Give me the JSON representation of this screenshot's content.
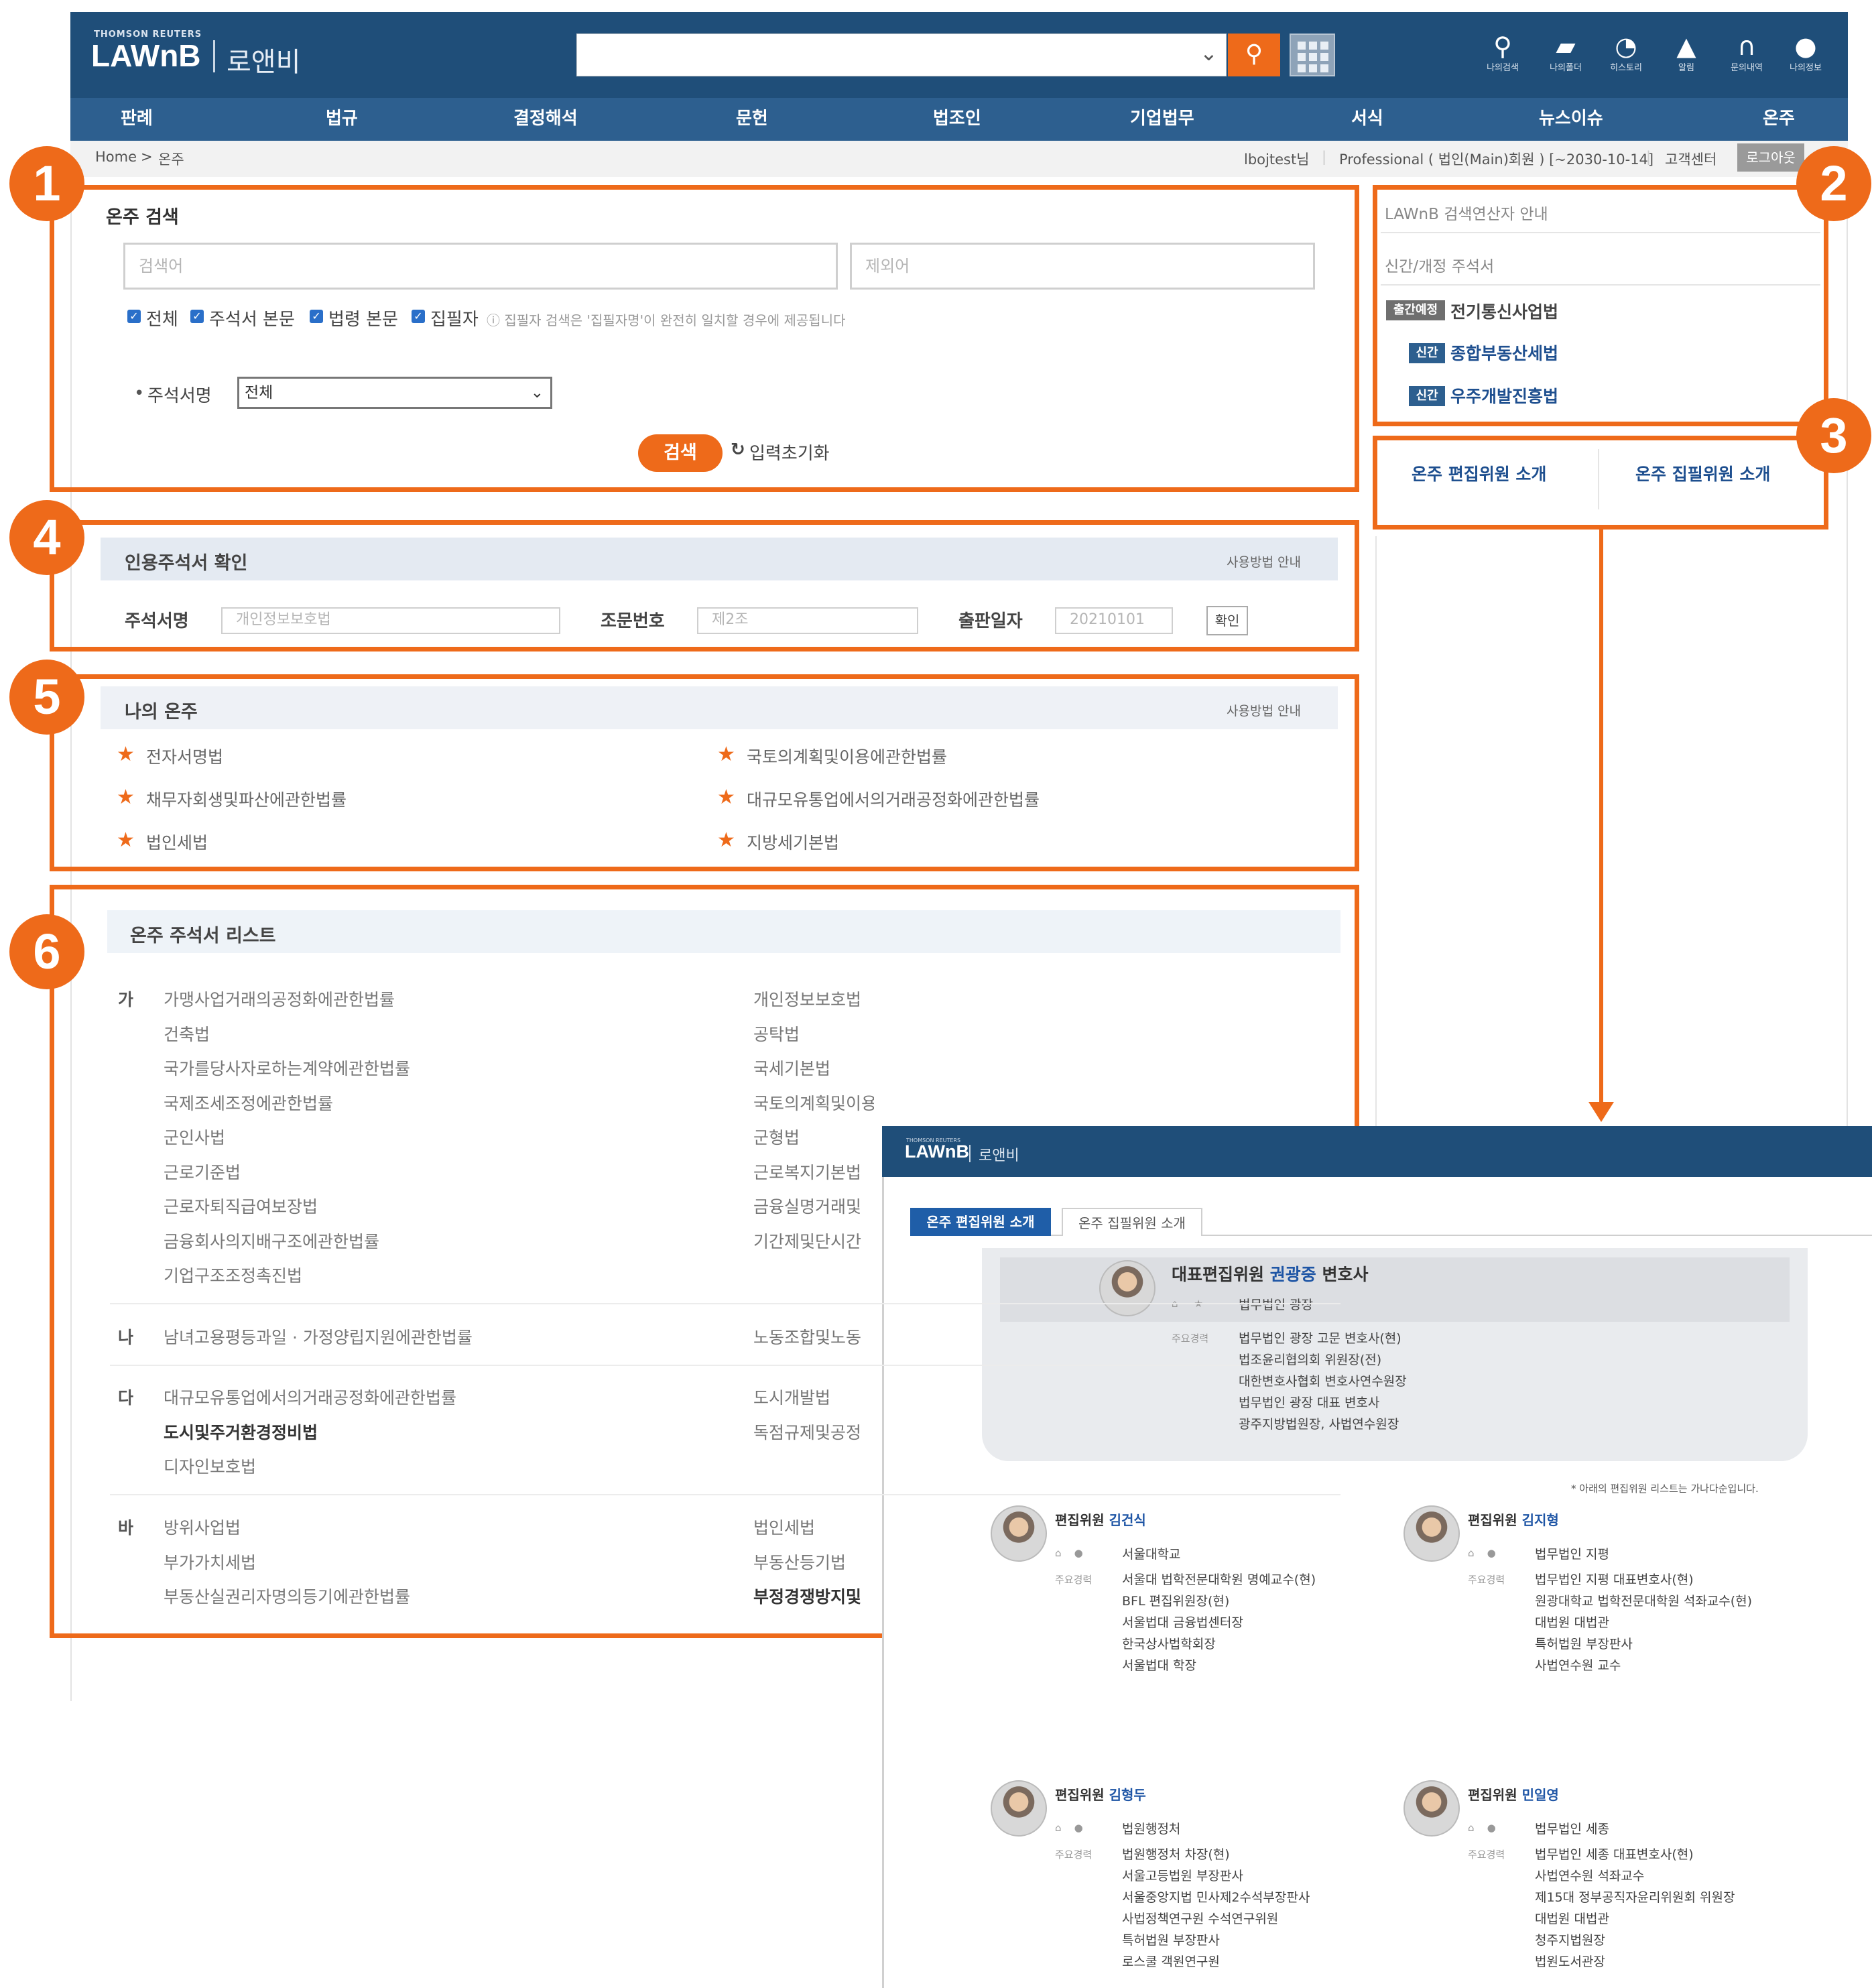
{
  "header": {
    "brand_small": "THOMSON REUTERS",
    "brand": "LAWnB",
    "brand_kor": "로앤비",
    "search_placeholder": "",
    "tools": [
      {
        "icon": "search-person-icon",
        "glyph": "⚲",
        "label": "나의검색"
      },
      {
        "icon": "folder-icon",
        "glyph": "▰",
        "label": "나의폴더"
      },
      {
        "icon": "history-icon",
        "glyph": "◔",
        "label": "히스토리"
      },
      {
        "icon": "bell-icon",
        "glyph": "▲",
        "label": "알림"
      },
      {
        "icon": "headset-icon",
        "glyph": "∩",
        "label": "문의내역"
      },
      {
        "icon": "user-icon",
        "glyph": "●",
        "label": "나의정보"
      }
    ]
  },
  "nav": [
    "판례",
    "법규",
    "결정해석",
    "문헌",
    "법조인",
    "기업법무",
    "서식",
    "뉴스이슈",
    "온주"
  ],
  "breadcrumb": {
    "home": "Home",
    "sep": ">",
    "current": "온주"
  },
  "account": {
    "user": "lbojtest님",
    "membership": "Professional ( 법인(Main)회원 ) [~2030-10-14]",
    "support": "고객센터",
    "logout": "로그아웃"
  },
  "badges": [
    "1",
    "2",
    "3",
    "4",
    "5",
    "6"
  ],
  "search": {
    "title": "온주 검색",
    "keyword_placeholder": "검색어",
    "exclude_placeholder": "제외어",
    "checks": [
      "전체",
      "주석서 본문",
      "법령 본문",
      "집필자"
    ],
    "note": "ⓘ 집필자 검색은 '집필자명'이 완전히 일치할 경우에 제공됩니다",
    "book_label": "주석서명",
    "book_value": "전체",
    "search_btn": "검색",
    "reset_btn": "입력초기화"
  },
  "side": {
    "operator_guide": "LAWnB 검색연산자 안내",
    "new_title": "신간/개정 주석서",
    "items": [
      {
        "tag": "출간예정",
        "name": "전기통신사업법"
      },
      {
        "tag": "신간",
        "name": "종합부동산세법"
      },
      {
        "tag": "신간",
        "name": "우주개발진흥법"
      }
    ],
    "editors_link": "온주 편집위원 소개",
    "writers_link": "온주 집필위원 소개"
  },
  "cite": {
    "title": "인용주석서 확인",
    "guide": "사용방법 안내",
    "book_label": "주석서명",
    "book_placeholder": "개인정보보호법",
    "article_label": "조문번호",
    "article_placeholder": "제2조",
    "date_label": "출판일자",
    "date_placeholder": "20210101",
    "confirm": "확인"
  },
  "my": {
    "title": "나의 온주",
    "guide": "사용방법 안내",
    "left": [
      "전자서명법",
      "채무자회생및파산에관한법률",
      "법인세법"
    ],
    "right": [
      "국토의계획및이용에관한법률",
      "대규모유통업에서의거래공정화에관한법률",
      "지방세기본법"
    ]
  },
  "list": {
    "title": "온주 주석서 리스트",
    "groups": [
      {
        "index": "가",
        "left": [
          "가맹사업거래의공정화에관한법률",
          "건축법",
          "국가를당사자로하는계약에관한법률",
          "국제조세조정에관한법률",
          "군인사법",
          "근로기준법",
          "근로자퇴직급여보장법",
          "금융회사의지배구조에관한법률",
          "기업구조조정촉진법"
        ],
        "right": [
          "개인정보보호법",
          "공탁법",
          "국세기본법",
          "국토의계획및이용에관한법률",
          "군형법",
          "근로복지기본법",
          "금융실명거래및",
          "기간제및단시간"
        ]
      },
      {
        "index": "나",
        "left": [
          "남녀고용평등과일 · 가정양립지원에관한법률"
        ],
        "right": [
          "노동조합및노동"
        ]
      },
      {
        "index": "다",
        "left": [
          "대규모유통업에서의거래공정화에관한법률",
          "도시및주거환경정비법",
          "디자인보호법"
        ],
        "right": [
          "도시개발법",
          "독점규제및공정"
        ]
      },
      {
        "index": "바",
        "left": [
          "방위사업법",
          "부가가치세법",
          "부동산실권리자명의등기에관한법률"
        ],
        "right": [
          "법인세법",
          "부동산등기법",
          "부정경쟁방지및"
        ]
      }
    ]
  },
  "popup": {
    "brand_small": "THOMSON REUTERS",
    "brand": "LAWnB",
    "brand_kor": "로앤비",
    "tab_active": "온주 편집위원 소개",
    "tab_inactive": "온주 집필위원 소개",
    "chief": {
      "role": "대표편집위원",
      "name": "권광중",
      "suffix": "변호사",
      "org": "법무법인 광장",
      "career_label": "주요경력",
      "career": [
        "법무법인 광장 고문 변호사(현)",
        "법조윤리협의회 위원장(전)",
        "대한변호사협회 변호사연수원장",
        "법무법인 광장 대표 변호사",
        "광주지방법원장, 사법연수원장"
      ]
    },
    "note": "* 아래의 편집위원 리스트는 가나다순입니다.",
    "members": [
      {
        "role": "편집위원",
        "name": "김건식",
        "org": "서울대학교",
        "career": [
          "서울대 법학전문대학원 명예교수(현)",
          "BFL 편집위원장(현)",
          "서울법대 금융법센터장",
          "한국상사법학회장",
          "서울법대 학장"
        ]
      },
      {
        "role": "편집위원",
        "name": "김지형",
        "org": "법무법인 지평",
        "career": [
          "법무법인 지평 대표변호사(현)",
          "원광대학교 법학전문대학원 석좌교수(현)",
          "대법원 대법관",
          "특허법원 부장판사",
          "사법연수원 교수"
        ]
      },
      {
        "role": "편집위원",
        "name": "김형두",
        "org": "법원행정처",
        "career": [
          "법원행정처 차장(현)",
          "서울고등법원 부장판사",
          "서울중앙지법 민사제2수석부장판사",
          "사법정책연구원 수석연구위원",
          "특허법원 부장판사",
          "로스쿨 객원연구원"
        ]
      },
      {
        "role": "편집위원",
        "name": "민일영",
        "org": "법무법인 세종",
        "career": [
          "법무법인 세종 대표변호사(현)",
          "사법연수원 석좌교수",
          "제15대 정부공직자윤리위원회 위원장",
          "대법원 대법관",
          "청주지법원장",
          "법원도서관장"
        ]
      }
    ],
    "career_label": "주요경력"
  }
}
